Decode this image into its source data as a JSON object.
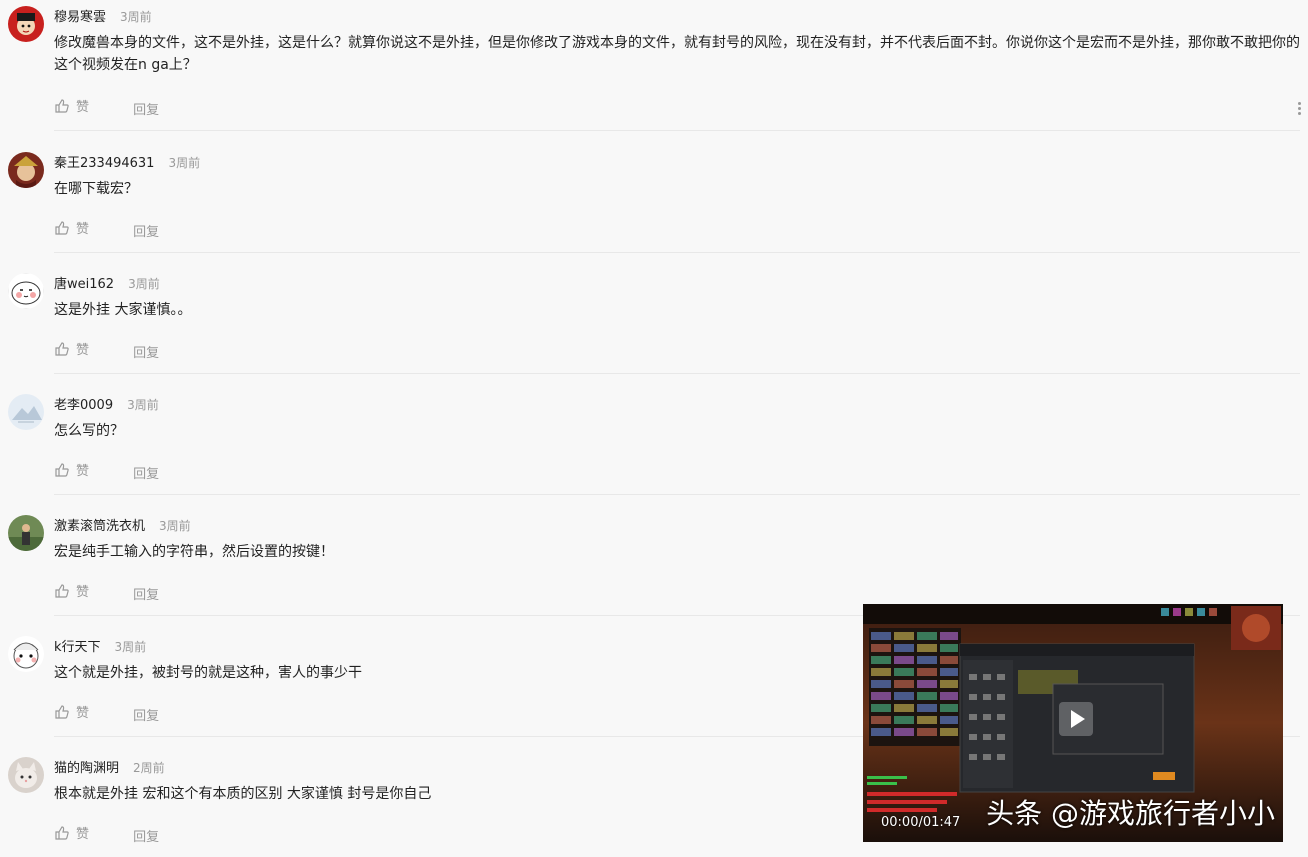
{
  "comments": [
    {
      "username": "穆易寒雲",
      "time": "3周前",
      "text": "修改魔兽本身的文件，这不是外挂，这是什么？就算你说这不是外挂，但是你修改了游戏本身的文件，就有封号的风险，现在没有封，并不代表后面不封。你说你这个是宏而不是外挂，那你敢不敢把你的这个视频发在n ga上？",
      "like_label": "赞",
      "reply_label": "回复"
    },
    {
      "username": "秦王233494631",
      "time": "3周前",
      "text": "在哪下载宏？",
      "like_label": "赞",
      "reply_label": "回复"
    },
    {
      "username": "唐wei162",
      "time": "3周前",
      "text": "这是外挂 大家谨慎。。",
      "like_label": "赞",
      "reply_label": "回复"
    },
    {
      "username": "老李0009",
      "time": "3周前",
      "text": "怎么写的？",
      "like_label": "赞",
      "reply_label": "回复"
    },
    {
      "username": "激素滚筒洗衣机",
      "time": "3周前",
      "text": "宏是纯手工输入的字符串，然后设置的按键！",
      "like_label": "赞",
      "reply_label": "回复"
    },
    {
      "username": "k行天下",
      "time": "3周前",
      "text": "这个就是外挂，被封号的就是这种，害人的事少干",
      "like_label": "赞",
      "reply_label": "回复"
    },
    {
      "username": "猫的陶渊明",
      "time": "2周前",
      "text": "根本就是外挂 宏和这个有本质的区别 大家谨慎 封号是你自己",
      "like_label": "赞",
      "reply_label": "回复"
    }
  ],
  "video": {
    "timecode": "00:00/01:47",
    "watermark": "头条 @游戏旅行者小小"
  },
  "icons": {
    "like": "thumbs-up-icon",
    "more": "more-vertical-icon",
    "play": "play-icon"
  }
}
